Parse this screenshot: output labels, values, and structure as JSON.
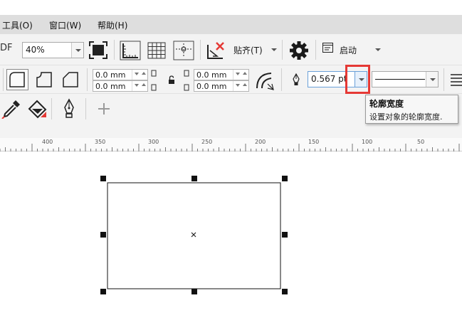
{
  "menu": {
    "tools": "工具(O)",
    "window": "窗口(W)",
    "help": "帮助(H)"
  },
  "toolbar": {
    "pdf_fragment": "DF",
    "zoom_value": "40%",
    "snap_label": "贴齐(T)",
    "launch_label": "启动"
  },
  "property_bar": {
    "corner_h_top": "0.0 mm",
    "corner_h_bottom": "0.0 mm",
    "corner_v_top": "0.0 mm",
    "corner_v_bottom": "0.0 mm",
    "outline_width": "0.567 pt"
  },
  "tooltip": {
    "title": "轮廓宽度",
    "description": "设置对象的轮廓宽度."
  },
  "ruler": {
    "labels": [
      "400",
      "350",
      "300",
      "250",
      "200",
      "150",
      "100",
      "50"
    ]
  },
  "colors": {
    "highlight": "#e53935",
    "menubar_bg": "#dedede",
    "toolbar_bg": "#f3f3f3"
  },
  "icons": [
    "fullscreen-icon",
    "rulers-icon",
    "grid-icon",
    "guidelines-icon",
    "snap-off-icon",
    "settings-gear-icon",
    "launch-window-icon",
    "round-corner-icon",
    "scallop-corner-icon",
    "chamfer-corner-icon",
    "lock-icon",
    "relative-corner-scaling-icon",
    "outline-pen-icon",
    "eyedropper-icon",
    "fill-bucket-icon",
    "pen-nib-icon",
    "add-tool-icon",
    "text-align-icon"
  ]
}
